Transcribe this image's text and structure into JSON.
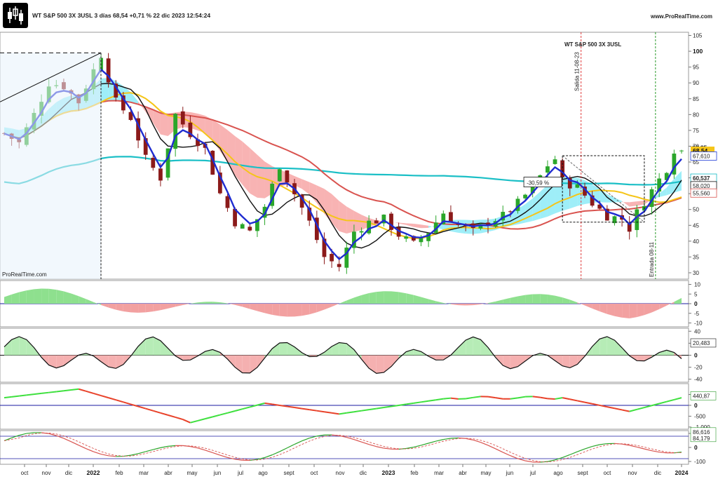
{
  "header": {
    "title": "WT S&P 500 3X 3USL 3 días 68,54 +0,71 % 22 dic 2023 12:54:24",
    "site": "www.ProRealTime.com",
    "logo_icon": "candlestick-chart-icon"
  },
  "chart_data": [
    {
      "panel": "price",
      "type": "candlestick",
      "watermark": "WT S&P 500 3X 3USL",
      "credit": "ProRealTime.com",
      "ylim": [
        28,
        106
      ],
      "yticks": [
        "105",
        "100",
        "95",
        "90",
        "85",
        "80",
        "75",
        "70",
        "65",
        "60",
        "55",
        "50",
        "45",
        "40",
        "35",
        "30"
      ],
      "x_labels": [
        "oct",
        "nov",
        "dic",
        "2022",
        "feb",
        "mar",
        "abr",
        "may",
        "jun",
        "jul",
        "ago",
        "sept",
        "oct",
        "nov",
        "dic",
        "2023",
        "feb",
        "mar",
        "abr",
        "may",
        "jun",
        "jul",
        "ago",
        "sept",
        "oct",
        "nov",
        "dic",
        "2024"
      ],
      "price_path": [
        [
          0,
          74
        ],
        [
          2,
          71
        ],
        [
          4,
          80
        ],
        [
          6,
          90
        ],
        [
          8,
          89
        ],
        [
          10,
          84
        ],
        [
          12,
          94
        ],
        [
          13,
          99
        ],
        [
          15,
          84
        ],
        [
          17,
          79
        ],
        [
          19,
          66
        ],
        [
          21,
          60
        ],
        [
          23,
          80
        ],
        [
          25,
          74
        ],
        [
          27,
          69
        ],
        [
          29,
          55
        ],
        [
          31,
          46
        ],
        [
          33,
          43
        ],
        [
          35,
          51
        ],
        [
          37,
          64
        ],
        [
          39,
          55
        ],
        [
          41,
          46
        ],
        [
          43,
          35
        ],
        [
          45,
          32
        ],
        [
          47,
          43
        ],
        [
          49,
          46
        ],
        [
          51,
          47
        ],
        [
          53,
          42
        ],
        [
          55,
          39
        ],
        [
          57,
          43
        ],
        [
          59,
          49
        ],
        [
          61,
          45
        ],
        [
          63,
          43
        ],
        [
          65,
          46
        ],
        [
          67,
          48
        ],
        [
          69,
          52
        ],
        [
          71,
          57
        ],
        [
          73,
          64
        ],
        [
          74,
          66
        ],
        [
          75,
          59
        ],
        [
          77,
          57
        ],
        [
          79,
          52
        ],
        [
          81,
          48
        ],
        [
          83,
          47
        ],
        [
          84,
          44
        ],
        [
          85,
          49
        ],
        [
          87,
          56
        ],
        [
          89,
          63
        ],
        [
          90,
          69
        ],
        [
          91,
          68.54
        ]
      ],
      "candle_count": 92,
      "last_price": "68,54",
      "price_label_top": "68,85",
      "labels_right": [
        {
          "text": "67,610",
          "color": "#1f3bd6"
        },
        {
          "text": "60,537",
          "color": "#12b9c4"
        },
        {
          "text": "58,020",
          "color": "#111111"
        },
        {
          "text": "55,560",
          "color": "#d9534f"
        }
      ],
      "annotations": {
        "salida": "Salida 11-08-23",
        "entrada": "Entrada 08-11",
        "drawdown": "-30,59 %"
      },
      "colors": {
        "up_candle": "#2aa62a",
        "down_candle": "#8b1a1a",
        "fast_ma": "#1f2cd0",
        "black_ma": "#111111",
        "yellow_ma": "#f5c518",
        "red_ma": "#d9534f",
        "teal_ma": "#1bbfc6",
        "cloud_bull": "#7ee8f5",
        "cloud_bear": "#f59a9a",
        "salida_line": "#e03a3a",
        "entrada_line": "#2a9a2a"
      }
    },
    {
      "panel": "oscillator_1",
      "type": "area",
      "ylim": [
        -12,
        12
      ],
      "yticks": [
        "10",
        "5",
        "0",
        "-5",
        "-10"
      ],
      "zero_color": "#1a1aa0"
    },
    {
      "panel": "oscillator_2",
      "type": "area",
      "ylim": [
        -45,
        45
      ],
      "yticks": [
        "40",
        "20",
        "0",
        "-20",
        "-40"
      ],
      "last_value": "20,483"
    },
    {
      "panel": "oscillator_3",
      "type": "line",
      "ylim": [
        -1100,
        1000
      ],
      "yticks": [
        "500",
        "0",
        "-500",
        "-1.000"
      ],
      "last_value": "440,87"
    },
    {
      "panel": "oscillator_4",
      "type": "line",
      "ylim": [
        -120,
        120
      ],
      "yticks": [
        "100",
        "0",
        "-100"
      ],
      "last_values": [
        "86,616",
        "84,179"
      ]
    }
  ]
}
